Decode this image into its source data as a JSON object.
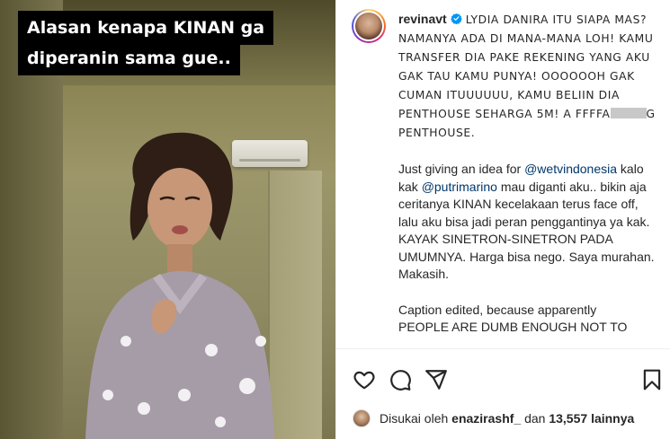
{
  "video": {
    "overlay_line_1": "Alasan kenapa KINAN ga",
    "overlay_line_2": "diperanin sama gue.."
  },
  "post": {
    "username": "revinavt",
    "verified": true,
    "caps_text_1": "LYDIA DANIRA ITU SIAPA MAS? NAMANYA ADA DI MANA-MANA LOH! KAMU TRANSFER DIA PAKE REKENING YANG AKU GAK TAU KAMU PUNYA! OOOOOOH GAK CUMAN ITUUUUUU, KAMU BELIIN DIA PENTHOUSE SEHARGA 5M! A FFFFA",
    "caps_text_2": "G PENTHOUSE.",
    "para2_part1": "Just giving an idea for ",
    "mention_1": "@wetvindonesia",
    "para2_part2": " kalo kak ",
    "mention_2": "@putrimarino",
    "para2_part3": " mau diganti aku.. bikin aja ceritanya KINAN kecelakaan terus face off, lalu aku bisa jadi peran penggantinya ya kak. KAYAK SINETRON-SINETRON PADA UMUMNYA. Harga bisa nego. Saya murahan. Makasih.",
    "para3": "Caption edited, because apparently",
    "para3_cut": "PEOPLE ARE DUMB ENOUGH NOT TO"
  },
  "likes": {
    "prefix": "Disukai oleh",
    "liker": "enazirashf_",
    "middle": "dan",
    "count": "13,557",
    "suffix": "lainnya"
  },
  "icons": {
    "like": "heart-icon",
    "comment": "comment-icon",
    "share": "share-icon",
    "save": "bookmark-icon",
    "verified": "verified-badge-icon"
  },
  "colors": {
    "verified_blue": "#0095f6",
    "mention": "#00376b",
    "text": "#262626",
    "caption_bg": "#000000"
  }
}
